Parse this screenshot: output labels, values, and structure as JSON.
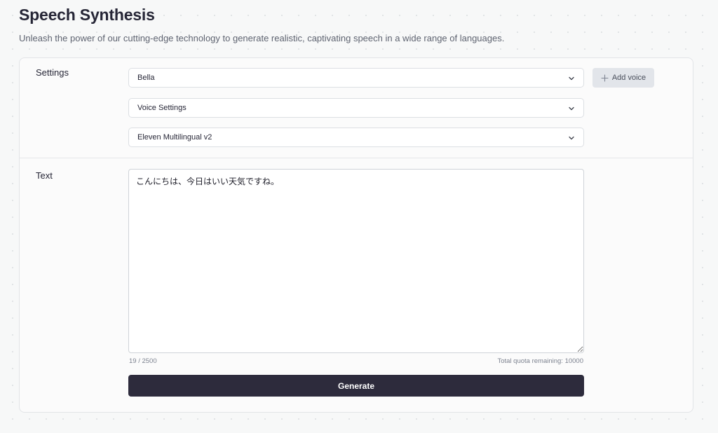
{
  "header": {
    "title": "Speech Synthesis",
    "subtitle": "Unleash the power of our cutting-edge technology to generate realistic, captivating speech in a wide range of languages."
  },
  "settings": {
    "label": "Settings",
    "voice_select": {
      "value": "Bella",
      "icon": "chevron-down-icon"
    },
    "voice_settings_select": {
      "value": "Voice Settings",
      "icon": "chevron-down-icon"
    },
    "model_select": {
      "value": "Eleven Multilingual v2",
      "icon": "chevron-down-icon"
    },
    "add_voice_button": {
      "label": "Add voice",
      "icon": "plus-icon"
    }
  },
  "text_section": {
    "label": "Text",
    "input_value": "こんにちは、今日はいい天気ですね。",
    "char_count": "19 / 2500",
    "quota": "Total quota remaining: 10000"
  },
  "generate_button": {
    "label": "Generate"
  },
  "colors": {
    "primary_button": "#2d2b3c",
    "add_voice_bg": "#e2e5ea",
    "muted_text": "#7d8390",
    "page_bg": "#f7f8f8"
  }
}
